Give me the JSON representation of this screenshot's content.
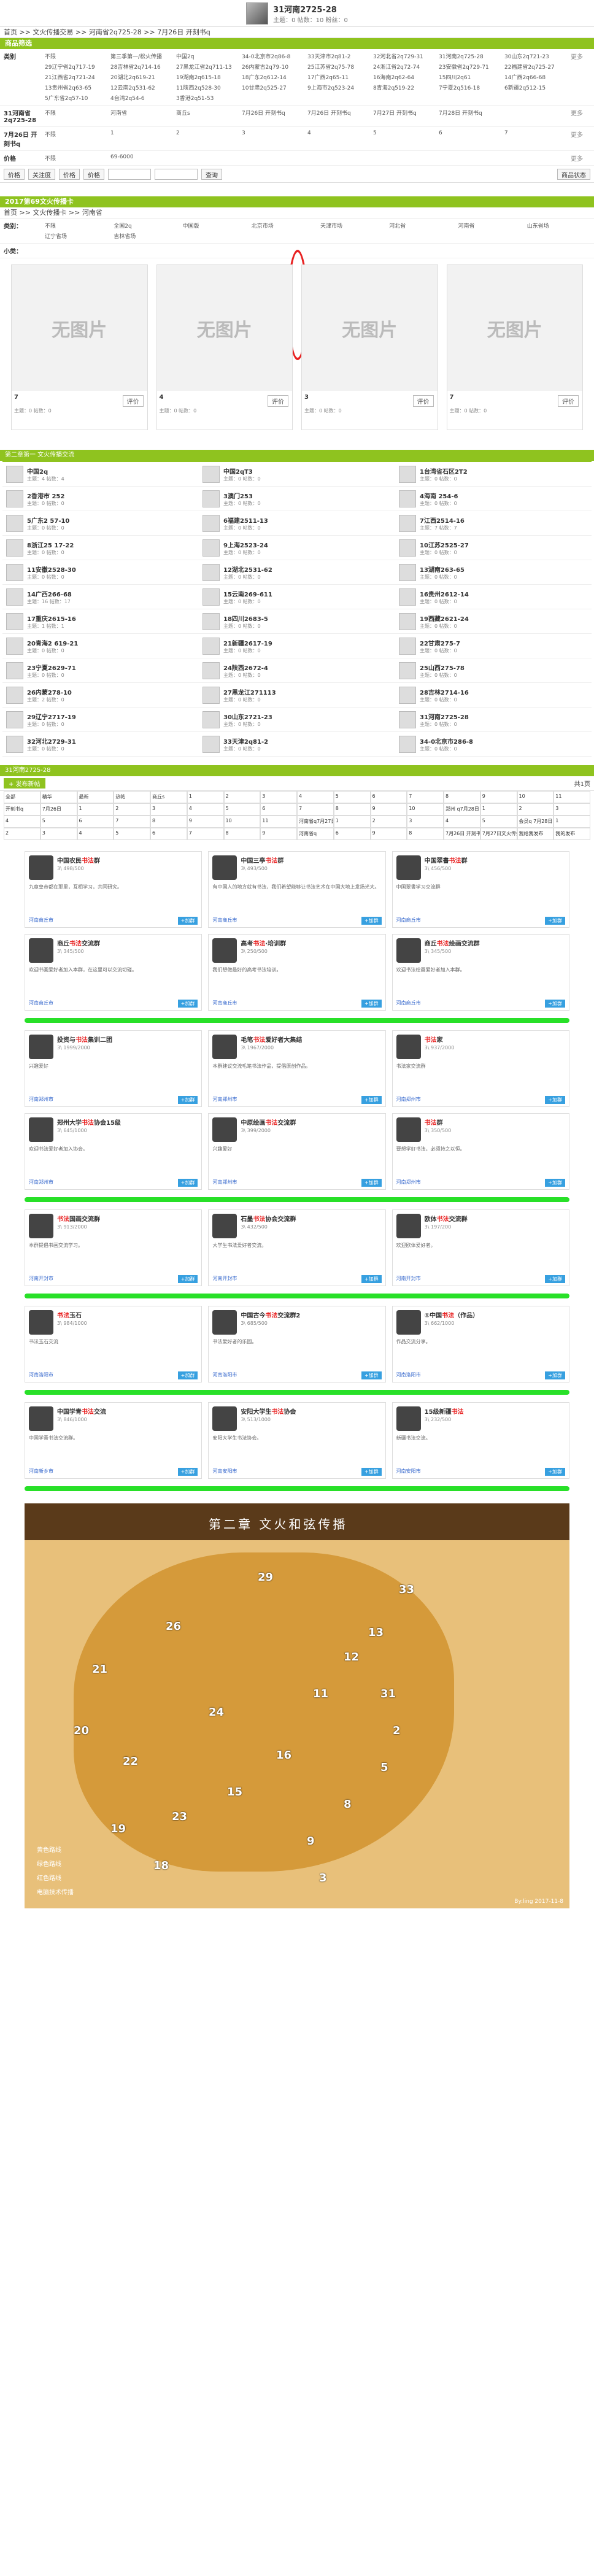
{
  "header": {
    "title": "31河南2725-28",
    "sub": "主题：0  帖数：10  粉丝：0"
  },
  "breadcrumb": "首页 >> 文火传播交易 >> 河南省2q725-28 >> 7月26日 开刻书q",
  "filter_section": "商品筛选",
  "filters": [
    {
      "label": "类别",
      "options": [
        "不限",
        "第三季第一/松火传播",
        "中国2q",
        "34-0北京市2q86-8",
        "33天津市2q81-2",
        "32河北省2q729-31",
        "31河南2q725-28",
        "30山东2q721-23",
        "29辽宁省2q717-19",
        "28吉林省2q714-16",
        "27黑龙江省2q711-13",
        "26内蒙古2q79-10",
        "25江苏省2q75-78",
        "24浙江省2q72-74",
        "23安徽省2q729-71",
        "22福建省2q725-27",
        "21江西省2q721-24",
        "20湖北2q619-21",
        "19湖南2q615-18",
        "18广东2q612-14",
        "17广西2q65-11",
        "16海南2q62-64",
        "15四川2q61",
        "14广西2q66-68",
        "13贵州省2q63-65",
        "12云南2q531-62",
        "11陕西2q528-30",
        "10甘肃2q525-27",
        "9上海市2q523-24",
        "8青海2q519-22",
        "7宁夏2q516-18",
        "6新疆2q512-15",
        "5广东省2q57-10",
        "4台湾2q54-6",
        "3香港2q51-53"
      ],
      "more": "更多"
    },
    {
      "label": "31河南省2q725-28",
      "options": [
        "不限",
        "河南省",
        "商丘s",
        "7月26日 开刻书q",
        "7月26日 开刻书q",
        "7月27日 开刻书q",
        "7月28日 开刻书q"
      ],
      "more": "更多"
    },
    {
      "label": "7月26日 开刻书q",
      "options": [
        "不限",
        "1",
        "2",
        "3",
        "4",
        "5",
        "6",
        "7"
      ],
      "more": "更多"
    },
    {
      "label": "价格",
      "options": [
        "不限",
        "69-6000"
      ],
      "more": "更多"
    }
  ],
  "toolbar": {
    "b1": "价格",
    "b2": "关注度",
    "b3": "价格",
    "b4": "价格",
    "b5": "查询",
    "status": "商品状态"
  },
  "section2": "2017第69文火传播卡",
  "breadcrumb2": "首页 >> 文火传播卡 >> 河南省",
  "big_filter_label": "类别：",
  "big_filter": [
    "不限",
    "全国2q",
    "中国版",
    "北京市场",
    "天津市场",
    "河北省",
    "河南省",
    "山东省场",
    "辽宁省场",
    "吉林省场"
  ],
  "small_filter_label": "小类：",
  "cards": [
    {
      "ph": "无图片",
      "num": "7",
      "cm": "评价",
      "meta": "主题：0  帖数：0"
    },
    {
      "ph": "无图片",
      "num": "4",
      "cm": "评价",
      "meta": "主题：0  帖数：0"
    },
    {
      "ph": "无图片",
      "num": "3",
      "cm": "评价",
      "meta": "主题：0  帖数：0"
    },
    {
      "ph": "无图片",
      "num": "7",
      "cm": "评价",
      "meta": "主题：0  帖数：0"
    }
  ],
  "grid_title": "第二章第一 文火传播交流",
  "grid": [
    {
      "n": "中国2q",
      "m": "主题：4  帖数：4"
    },
    {
      "n": "中国2qT3",
      "m": "主题：0  帖数：0"
    },
    {
      "n": "1台湾省石区2T2",
      "m": "主题：0  帖数：0"
    },
    {
      "n": "2香港市 252",
      "m": "主题：0  帖数：0"
    },
    {
      "n": "3澳门253",
      "m": "主题：0  帖数：0"
    },
    {
      "n": "4海南 254-6",
      "m": "主题：0  帖数：0"
    },
    {
      "n": "5广东2 57-10",
      "m": "主题：0  帖数：0"
    },
    {
      "n": "6福建2511-13",
      "m": "主题：0  帖数：0"
    },
    {
      "n": "7江西2514-16",
      "m": "主题：7  帖数：7"
    },
    {
      "n": "8浙江25 17-22",
      "m": "主题：0  帖数：0"
    },
    {
      "n": "9上海2523-24",
      "m": "主题：0  帖数：0"
    },
    {
      "n": "10江苏2525-27",
      "m": "主题：0  帖数：0"
    },
    {
      "n": "11安徽2528-30",
      "m": "主题：0  帖数：0"
    },
    {
      "n": "12湖北2531-62",
      "m": "主题：0  帖数：0"
    },
    {
      "n": "13湖南263-65",
      "m": "主题：0  帖数：0"
    },
    {
      "n": "14广西266-68",
      "m": "主题：16  帖数：17"
    },
    {
      "n": "15云南269-611",
      "m": "主题：0  帖数：0"
    },
    {
      "n": "16贵州2612-14",
      "m": "主题：0  帖数：0"
    },
    {
      "n": "17重庆2615-16",
      "m": "主题：1  帖数：1"
    },
    {
      "n": "18四川2683-5",
      "m": "主题：0  帖数：0"
    },
    {
      "n": "19西藏2621-24",
      "m": "主题：0  帖数：0"
    },
    {
      "n": "20青海2 619-21",
      "m": "主题：0  帖数：0"
    },
    {
      "n": "21新疆2617-19",
      "m": "主题：0  帖数：0"
    },
    {
      "n": "22甘肃275-7",
      "m": "主题：0  帖数：0"
    },
    {
      "n": "23宁夏2629-71",
      "m": "主题：0  帖数：0"
    },
    {
      "n": "24陕西2672-4",
      "m": "主题：0  帖数：0"
    },
    {
      "n": "25山西275-78",
      "m": "主题：0  帖数：0"
    },
    {
      "n": "26内蒙278-10",
      "m": "主题：2  帖数：0"
    },
    {
      "n": "27黑龙江271113",
      "m": "主题：0  帖数：0"
    },
    {
      "n": "28吉林2714-16",
      "m": "主题：0  帖数：0"
    },
    {
      "n": "29辽宁2717-19",
      "m": "主题：0  帖数：0"
    },
    {
      "n": "30山东2721-23",
      "m": "主题：0  帖数：0"
    },
    {
      "n": "31河南2725-28",
      "m": "主题：0  帖数：0"
    },
    {
      "n": "32河北2729-31",
      "m": "主题：0  帖数：0"
    },
    {
      "n": "33天津2q81-2",
      "m": "主题：0  帖数：0"
    },
    {
      "n": "34-0北京市286-8",
      "m": "主题：0  帖数：0"
    }
  ],
  "list_title": "31河南2725-28",
  "list_add": "+ 发布新帖",
  "list_page": "共1页",
  "rtable": [
    "全部",
    "精华",
    "最新",
    "热帖",
    "商丘s",
    "1",
    "2",
    "3",
    "4",
    "5",
    "6",
    "7",
    "8",
    "9",
    "10",
    "11",
    "开刻书q",
    "7月26日",
    "1",
    "2",
    "3",
    "4",
    "5",
    "6",
    "7",
    "8",
    "9",
    "10",
    "郑州 q7月28日",
    "1",
    "2",
    "3",
    "4",
    "5",
    "6",
    "7",
    "8",
    "9",
    "10",
    "11",
    "河南省q7月27日",
    "1",
    "2",
    "3",
    "4",
    "5",
    "会员q 7月28日",
    "1",
    "2",
    "3",
    "4",
    "5",
    "6",
    "7",
    "8",
    "9",
    "河南省q",
    "6",
    "9",
    "8",
    "7月26日 开刻书q",
    "7月27日文火传播",
    "我给我发布",
    "我的发布"
  ],
  "groups": [
    {
      "nm": "中国农民",
      "kw": "书法",
      "tail": "群",
      "st": "3\\ 498/500",
      "ds": "九章皇帝都在那里，互相学习，共同研究。",
      "loc": "河南商丘市",
      "btn": "+加群"
    },
    {
      "nm": "中国三亭",
      "kw": "书法",
      "tail": "群",
      "st": "3\\ 493/500",
      "ds": "有中国人的地方就有书法，我们希望能够让书法艺术在中国大地上发扬光大。",
      "loc": "河南商丘市",
      "btn": "+加群"
    },
    {
      "nm": "中国翠書",
      "kw": "书法",
      "tail": "群",
      "st": "3\\ 456/500",
      "ds": "中国翠書学习交流群",
      "loc": "河南商丘市",
      "btn": "+加群"
    },
    {
      "nm": "商丘",
      "kw": "书法",
      "tail": "交流群",
      "st": "3\\ 345/500",
      "ds": "欢迎书画爱好者加入本群，在这里可以交流切磋。",
      "loc": "河南商丘市",
      "btn": "+加群"
    },
    {
      "nm": "高考",
      "kw": "书法",
      "tail": "·培训群",
      "st": "3\\ 250/500",
      "ds": "我们想做最好的高考书法培训。",
      "loc": "河南商丘市",
      "btn": "+加群"
    },
    {
      "nm": "商丘",
      "kw": "书法",
      "tail": "绘画交流群",
      "st": "3\\ 345/500",
      "ds": "欢迎书法绘画爱好者加入本群。",
      "loc": "河南商丘市",
      "btn": "+加群"
    },
    {
      "nm": "投资与",
      "kw": "书法",
      "tail": "集训二团",
      "st": "3\\ 1999/2000",
      "ds": "兴趣爱好",
      "loc": "河南郑州市",
      "btn": "+加群"
    },
    {
      "nm": "毛笔",
      "kw": "书法",
      "tail": "爱好者大集结",
      "st": "3\\ 1967/2000",
      "ds": "本群建议交流毛笔书法作品，提倡原创作品。",
      "loc": "河南郑州市",
      "btn": "+加群"
    },
    {
      "nm": "",
      "kw": "书法",
      "tail": "家",
      "st": "3\\ 937/2000",
      "ds": "书法家交流群",
      "loc": "河南郑州市",
      "btn": "+加群"
    },
    {
      "nm": "郑州大学",
      "kw": "书法",
      "tail": "协会15级",
      "st": "3\\ 645/1000",
      "ds": "欢迎书法爱好者加入协会。",
      "loc": "河南郑州市",
      "btn": "+加群"
    },
    {
      "nm": "中原绘画",
      "kw": "书法",
      "tail": "交流群",
      "st": "3\\ 399/2000",
      "ds": "兴趣爱好",
      "loc": "河南郑州市",
      "btn": "+加群"
    },
    {
      "nm": "",
      "kw": "书法",
      "tail": "群",
      "st": "3\\ 350/500",
      "ds": "要想学好书法，必须持之以恒。",
      "loc": "河南郑州市",
      "btn": "+加群"
    },
    {
      "nm": "",
      "kw": "书法",
      "tail": "国画交流群",
      "st": "3\\ 913/2000",
      "ds": "本群提倡书画交流学习。",
      "loc": "河南开封市",
      "btn": "+加群"
    },
    {
      "nm": "石墨",
      "kw": "书法",
      "tail": "协会交流群",
      "st": "3\\ 432/500",
      "ds": "大学生书法爱好者交流。",
      "loc": "河南开封市",
      "btn": "+加群"
    },
    {
      "nm": "欧体",
      "kw": "书法",
      "tail": "交流群",
      "st": "3\\ 197/200",
      "ds": "欢迎欧体爱好者。",
      "loc": "河南开封市",
      "btn": "+加群"
    },
    {
      "nm": "",
      "kw": "书法",
      "tail": "玉石",
      "st": "3\\ 984/1000",
      "ds": "书法玉石交流",
      "loc": "河南洛阳市",
      "btn": "+加群"
    },
    {
      "nm": "中国古今",
      "kw": "书法",
      "tail": "交流群2",
      "st": "3\\ 685/500",
      "ds": "书法爱好者的乐园。",
      "loc": "河南洛阳市",
      "btn": "+加群"
    },
    {
      "nm": "①中国",
      "kw": "书法",
      "tail": "（作品）",
      "st": "3\\ 662/1000",
      "ds": "作品交流分享。",
      "loc": "河南洛阳市",
      "btn": "+加群"
    },
    {
      "nm": "中国学青",
      "kw": "书法",
      "tail": "交流",
      "st": "3\\ 846/1000",
      "ds": "中国学青书法交流群。",
      "loc": "河南新乡市",
      "btn": "+加群"
    },
    {
      "nm": "安阳大学生",
      "kw": "书法",
      "tail": "协会",
      "st": "3\\ 513/1000",
      "ds": "安阳大学生书法协会。",
      "loc": "河南安阳市",
      "btn": "+加群"
    },
    {
      "nm": "15级新疆",
      "kw": "书法",
      "tail": "",
      "st": "3\\ 232/500",
      "ds": "新疆书法交流。",
      "loc": "河南安阳市",
      "btn": "+加群"
    }
  ],
  "map": {
    "title": "第二章 文火和弦传播",
    "leg": [
      "黄色路线",
      "绿色路线",
      "红色路线",
      "电脑技术传播"
    ],
    "wm": "By:ling  2017-11-8",
    "cities": [
      "21",
      "26",
      "29",
      "20",
      "22",
      "24",
      "23",
      "19",
      "18",
      "15",
      "16",
      "11",
      "12",
      "13",
      "9",
      "8",
      "5",
      "2",
      "3",
      "33",
      "31"
    ]
  }
}
